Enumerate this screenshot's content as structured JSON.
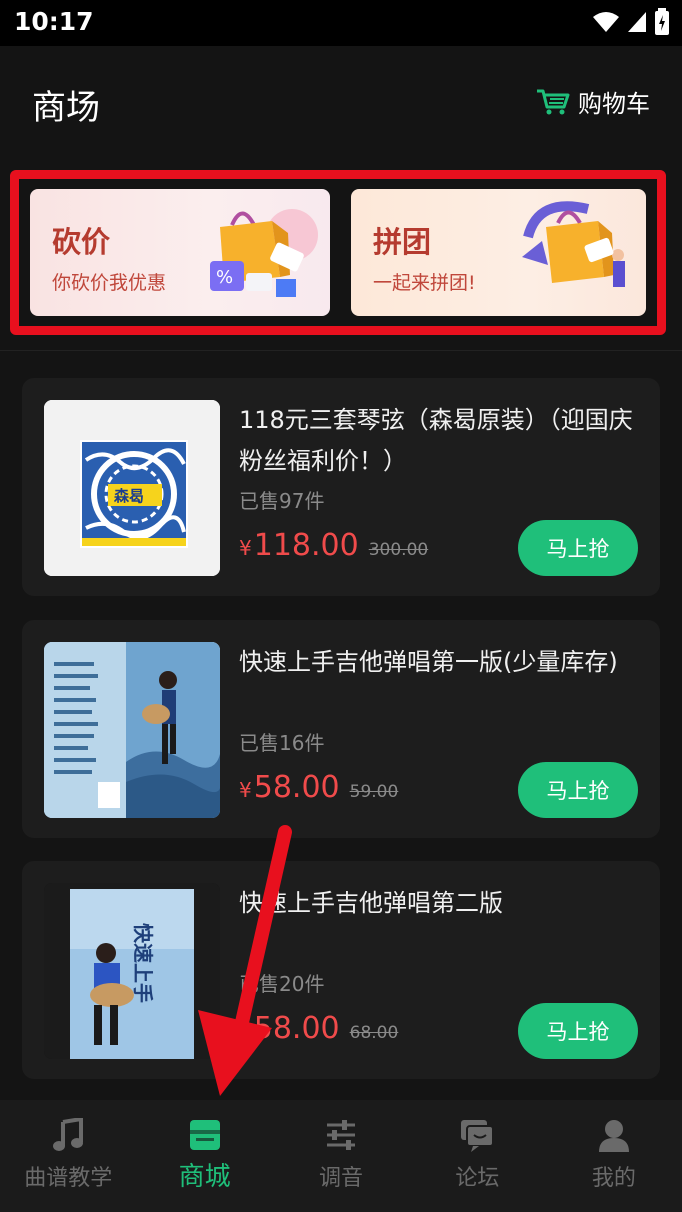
{
  "status_bar": {
    "time": "10:17",
    "icons": [
      "wifi-icon",
      "signal-icon",
      "battery-icon"
    ]
  },
  "header": {
    "title": "商场",
    "cart_label": "购物车"
  },
  "promos": [
    {
      "title": "砍价",
      "subtitle": "你砍价我优惠"
    },
    {
      "title": "拼团",
      "subtitle": "一起来拼团!"
    }
  ],
  "products": [
    {
      "title": "118元三套琴弦（森曷原装）（迎国庆粉丝福利价！）",
      "sold": "已售97件",
      "price_symbol": "¥",
      "price": "118.00",
      "original_price": "300.00",
      "buy_label": "马上抢",
      "cover_text": "森曷"
    },
    {
      "title": "快速上手吉他弹唱第一版(少量库存)",
      "sold": "已售16件",
      "price_symbol": "¥",
      "price": "58.00",
      "original_price": "59.00",
      "buy_label": "马上抢"
    },
    {
      "title": "快速上手吉他弹唱第二版",
      "sold": "已售20件",
      "price_symbol": "¥",
      "price": "58.00",
      "original_price": "68.00",
      "buy_label": "马上抢",
      "cover_text": "快速上手"
    }
  ],
  "tabs": [
    {
      "label": "曲谱教学",
      "icon": "music-note-icon",
      "active": false
    },
    {
      "label": "商城",
      "icon": "store-icon",
      "active": true
    },
    {
      "label": "调音",
      "icon": "sliders-icon",
      "active": false
    },
    {
      "label": "论坛",
      "icon": "chat-icon",
      "active": false
    },
    {
      "label": "我的",
      "icon": "user-icon",
      "active": false
    }
  ],
  "colors": {
    "accent": "#1fbf7a",
    "price": "#f04b4b",
    "highlight_border": "#e8101e",
    "annotation_arrow": "#e8101e"
  }
}
